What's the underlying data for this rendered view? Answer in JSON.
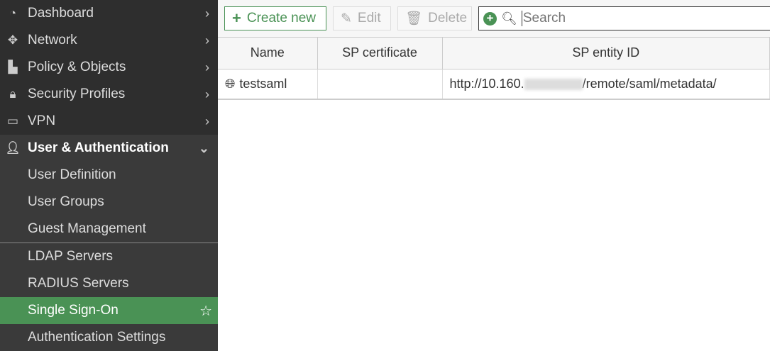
{
  "sidebar": {
    "items": [
      {
        "label": "Dashboard",
        "icon": "dashboard-icon"
      },
      {
        "label": "Network",
        "icon": "move-arrows-icon"
      },
      {
        "label": "Policy & Objects",
        "icon": "policy-icon"
      },
      {
        "label": "Security Profiles",
        "icon": "lock-icon"
      },
      {
        "label": "VPN",
        "icon": "laptop-icon"
      }
    ],
    "section": {
      "label": "User & Authentication",
      "icon": "user-icon",
      "subitems": [
        "User Definition",
        "User Groups",
        "Guest Management",
        "LDAP Servers",
        "RADIUS Servers",
        "Single Sign-On",
        "Authentication Settings"
      ]
    }
  },
  "toolbar": {
    "create": "Create new",
    "edit": "Edit",
    "delete": "Delete",
    "search_placeholder": "Search"
  },
  "table": {
    "columns": [
      "Name",
      "SP certificate",
      "SP entity ID"
    ],
    "rows": [
      {
        "name": "testsaml",
        "certificate": "",
        "entity_prefix": "http://10.160.",
        "entity_suffix": "/remote/saml/metadata/"
      }
    ]
  },
  "colors": {
    "accent": "#4a9255",
    "sidebar": "#2e2e2e"
  }
}
